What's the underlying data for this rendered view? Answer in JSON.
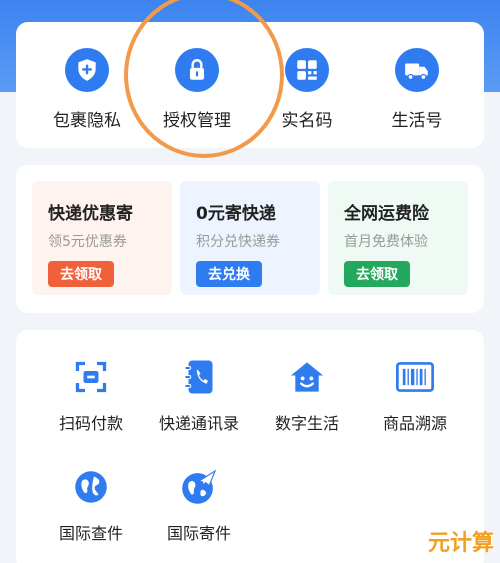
{
  "quick_actions": [
    {
      "label": "包裹隐私",
      "icon": "shield-plus-icon"
    },
    {
      "label": "授权管理",
      "icon": "lock-icon"
    },
    {
      "label": "实名码",
      "icon": "grid-code-icon"
    },
    {
      "label": "生活号",
      "icon": "truck-icon"
    }
  ],
  "promos": [
    {
      "title": "快递优惠寄",
      "subtitle": "领5元优惠券",
      "button": "去领取",
      "bg": "#fff3ef",
      "button_color": "#f0603a"
    },
    {
      "title": "0元寄快递",
      "subtitle": "积分兑快递券",
      "button": "去兑换",
      "bg": "#eef4ff",
      "button_color": "#2f7cf0"
    },
    {
      "title": "全网运费险",
      "subtitle": "首月免费体验",
      "button": "去领取",
      "bg": "#eefaf3",
      "button_color": "#23a85d"
    }
  ],
  "services": [
    {
      "label": "扫码付款",
      "icon": "scan-pay-icon"
    },
    {
      "label": "快递通讯录",
      "icon": "contacts-phone-icon"
    },
    {
      "label": "数字生活",
      "icon": "smile-house-icon"
    },
    {
      "label": "商品溯源",
      "icon": "barcode-icon"
    },
    {
      "label": "国际查件",
      "icon": "globe-icon"
    },
    {
      "label": "国际寄件",
      "icon": "globe-plane-icon"
    }
  ],
  "watermark": "元计算",
  "colors": {
    "primary": "#2f7cf0",
    "annotation": "#f2994a"
  }
}
